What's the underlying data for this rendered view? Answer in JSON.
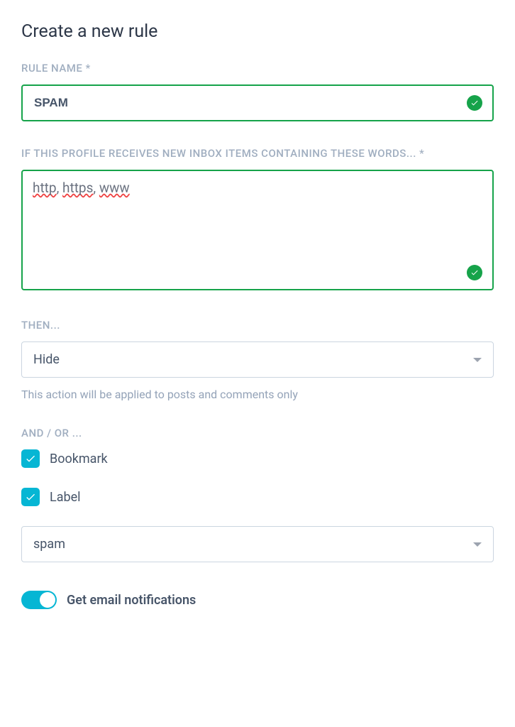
{
  "page": {
    "title": "Create a new rule"
  },
  "ruleName": {
    "label": "RULE NAME *",
    "value": "SPAM",
    "valid": true
  },
  "keywords": {
    "label": "IF THIS PROFILE RECEIVES NEW INBOX ITEMS CONTAINING THESE WORDS... *",
    "words": [
      "http",
      "https",
      "www"
    ],
    "separator": ", ",
    "valid": true
  },
  "action": {
    "label": "THEN...",
    "selected": "Hide",
    "helperText": "This action will be applied to posts and comments only"
  },
  "andOr": {
    "label": "AND / OR ...",
    "bookmark": {
      "label": "Bookmark",
      "checked": true
    },
    "label_option": {
      "label": "Label",
      "checked": true,
      "selected": "spam"
    }
  },
  "notifications": {
    "label": "Get email notifications",
    "enabled": true
  }
}
